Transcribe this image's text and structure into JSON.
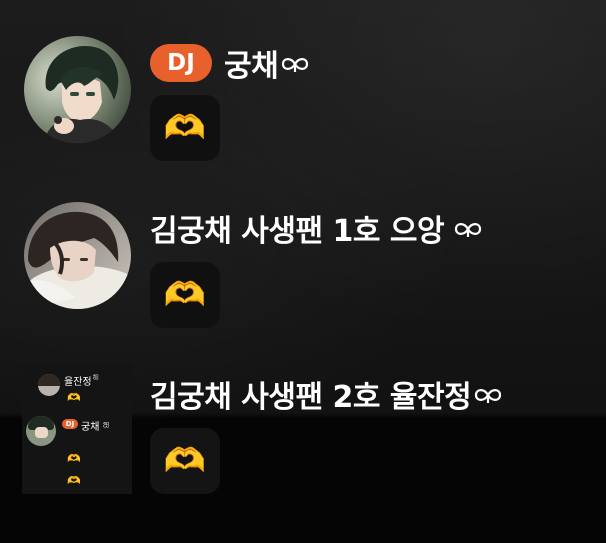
{
  "colors": {
    "dj_badge": "#e8612c",
    "background_top": "#1c1c1c",
    "background_bottom": "#050505",
    "reaction_tile": "#101010"
  },
  "icons": {
    "reaction": "heart-hands-icon",
    "name_suffix": "infinity-heart-icon"
  },
  "entries": [
    {
      "badge": "DJ",
      "name": "궁채",
      "reaction": "🫶"
    },
    {
      "name": "김궁채 사생팬 1호 으앙",
      "reaction": "🫶"
    },
    {
      "name": "김궁채 사생팬 2호 율잔정",
      "reaction": "🫶",
      "avatar_preview": {
        "top_name": "율잔정",
        "top_suffix": "ஐ",
        "badge": "DJ",
        "name": "궁채",
        "reaction": "🫶"
      }
    }
  ]
}
